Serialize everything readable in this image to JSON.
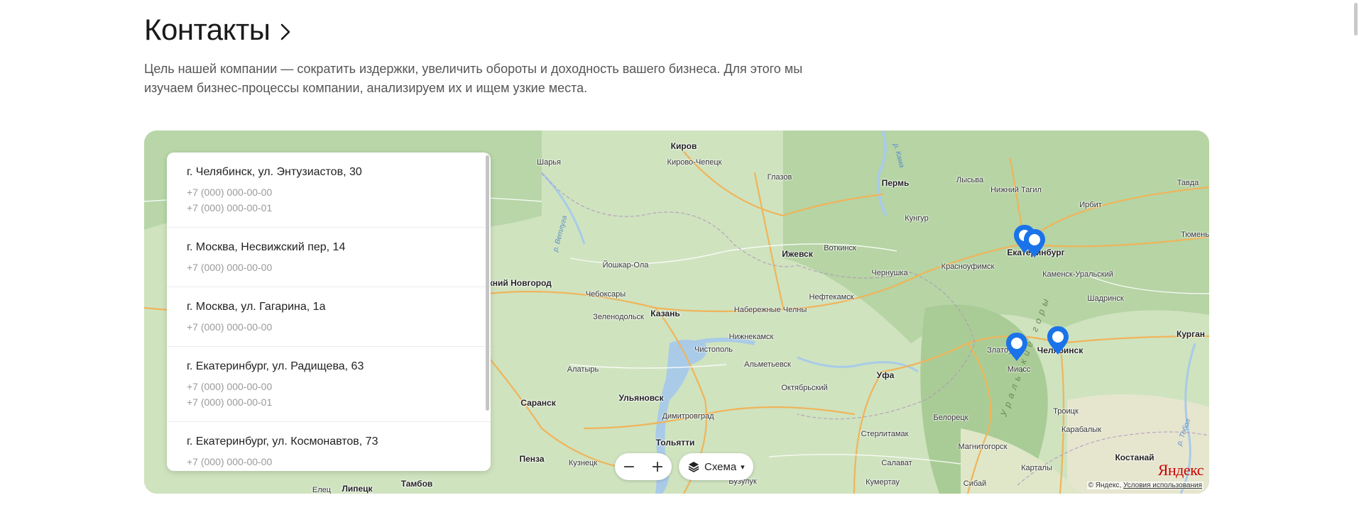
{
  "header": {
    "title": "Контакты",
    "lead": "Цель нашей компании — сократить издержки, увеличить обороты и доходность вашего бизнеса. Для этого мы изучаем бизнес-процессы компании, анализируем их и ищем узкие места."
  },
  "addresses": [
    {
      "address": "г. Челябинск, ул. Энтузиастов, 30",
      "phones": [
        "+7 (000) 000-00-00",
        "+7 (000) 000-00-01"
      ]
    },
    {
      "address": "г. Москва, Несвижский пер, 14",
      "phones": [
        "+7 (000) 000-00-00"
      ]
    },
    {
      "address": "г. Москва, ул. Гагарина, 1а",
      "phones": [
        "+7 (000) 000-00-00"
      ]
    },
    {
      "address": "г. Екатеринбург, ул. Радищева, 63",
      "phones": [
        "+7 (000) 000-00-00",
        "+7 (000) 000-00-01"
      ]
    },
    {
      "address": "г. Екатеринбург, ул. Космонавтов, 73",
      "phones": [
        "+7 (000) 000-00-00"
      ]
    }
  ],
  "map": {
    "layers_label": "Схема",
    "zoom_out": "−",
    "zoom_in": "+",
    "logo": "Яндекс",
    "copyright_prefix": "© Яндекс",
    "terms_link": "Условия использования",
    "colors": {
      "water": "#a9cbe8",
      "roads": "#f0b45a",
      "land": "#cfe3bf",
      "forest": "#b8d6a8",
      "marker": "#1a73e8"
    }
  },
  "cities": [
    {
      "name": "Киров"
    },
    {
      "name": "Кирово-Чепецк"
    },
    {
      "name": "Шарья"
    },
    {
      "name": "Глазов"
    },
    {
      "name": "Пермь"
    },
    {
      "name": "Лысьва"
    },
    {
      "name": "Нижний Тагил"
    },
    {
      "name": "Ирбит"
    },
    {
      "name": "Тавда"
    },
    {
      "name": "Тюмень"
    },
    {
      "name": "Кунгур"
    },
    {
      "name": "Екатеринбург"
    },
    {
      "name": "Каменск-Уральский"
    },
    {
      "name": "Ижевск"
    },
    {
      "name": "Воткинск"
    },
    {
      "name": "Чернушка"
    },
    {
      "name": "Красноуфимск"
    },
    {
      "name": "Йошкар-Ола"
    },
    {
      "name": "Чебоксары"
    },
    {
      "name": "Казань"
    },
    {
      "name": "Зеленодольск"
    },
    {
      "name": "Набережные Челны"
    },
    {
      "name": "Нефтекамск"
    },
    {
      "name": "Нижнекамск"
    },
    {
      "name": "Чистополь"
    },
    {
      "name": "Шадринск"
    },
    {
      "name": "Курган"
    },
    {
      "name": "Альметьевск"
    },
    {
      "name": "Алатырь"
    },
    {
      "name": "Уфа"
    },
    {
      "name": "Златоуст"
    },
    {
      "name": "Миасс"
    },
    {
      "name": "Челябинск"
    },
    {
      "name": "Октябрьский"
    },
    {
      "name": "Белорецк"
    },
    {
      "name": "Саранск"
    },
    {
      "name": "Ульяновск"
    },
    {
      "name": "Димитровград"
    },
    {
      "name": "Троицк"
    },
    {
      "name": "Карабалык"
    },
    {
      "name": "Стерлитамак"
    },
    {
      "name": "Тольятти"
    },
    {
      "name": "Магнитогорск"
    },
    {
      "name": "Пенза"
    },
    {
      "name": "Кузнецк"
    },
    {
      "name": "Салават"
    },
    {
      "name": "Костанай"
    },
    {
      "name": "Карталы"
    },
    {
      "name": "Тамбов"
    },
    {
      "name": "Липецк"
    },
    {
      "name": "Елец"
    },
    {
      "name": "Бузулук"
    },
    {
      "name": "Кумертау"
    },
    {
      "name": "Сибай"
    },
    {
      "name": "Нижний Новгород"
    }
  ],
  "rivers": [
    {
      "name": "р. Ветлуга"
    },
    {
      "name": "р. Кама"
    },
    {
      "name": "р. Тобол"
    },
    {
      "name": "Уральские горы"
    }
  ]
}
